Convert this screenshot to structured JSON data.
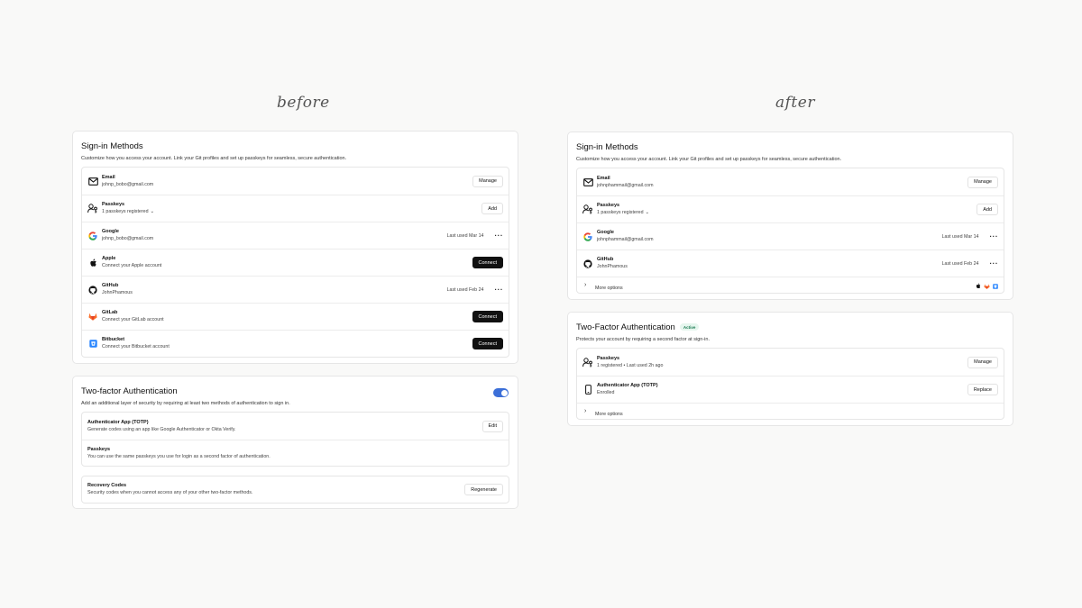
{
  "captions": {
    "before": "before",
    "after": "after"
  },
  "before": {
    "signin": {
      "title": "Sign-in Methods",
      "desc": "Customize how you access your account. Link your Git profiles and set up passkeys for seamless, secure authentication.",
      "email": {
        "label": "Email",
        "value": "johnp_bobo@gmail.com",
        "button": "Manage",
        "icon": "mail-icon"
      },
      "passkeys": {
        "label": "Passkeys",
        "value": "1 passkeys registered",
        "button": "Add",
        "icon": "passkey-icon"
      },
      "google": {
        "label": "Google",
        "value": "johnp_bobo@gmail.com",
        "last_used": "Last used Mar 14",
        "icon": "google-icon"
      },
      "apple": {
        "label": "Apple",
        "value": "Connect your Apple account",
        "button": "Connect",
        "icon": "apple-icon"
      },
      "github": {
        "label": "GitHub",
        "value": "JohnPhamous",
        "last_used": "Last used Feb 24",
        "icon": "github-icon"
      },
      "gitlab": {
        "label": "GitLab",
        "value": "Connect your GitLab account",
        "button": "Connect",
        "icon": "gitlab-icon"
      },
      "bitbucket": {
        "label": "Bitbucket",
        "value": "Connect your Bitbucket account",
        "button": "Connect",
        "icon": "bitbucket-icon"
      }
    },
    "twofa": {
      "title": "Two-factor Authentication",
      "desc": "Add an additional layer of security by requiring at least two methods of authentication to sign in.",
      "toggle_on": true,
      "authenticator": {
        "label": "Authenticator App (TOTP)",
        "value": "Generate codes using an app like Google Authenticator or Okta Verify.",
        "button": "Edit"
      },
      "passkeys": {
        "label": "Passkeys",
        "value": "You can use the same passkeys you use for login as a second factor of authentication."
      },
      "recovery": {
        "label": "Recovery Codes",
        "value": "Security codes when you cannot access any of your other two-factor methods.",
        "button": "Regenerate"
      }
    }
  },
  "after": {
    "signin": {
      "title": "Sign-in Methods",
      "desc": "Customize how you access your account. Link your Git profiles and set up passkeys for seamless, secure authentication.",
      "email": {
        "label": "Email",
        "value": "johnphammail@gmail.com",
        "button": "Manage"
      },
      "passkeys": {
        "label": "Passkeys",
        "value": "1 passkeys registered",
        "button": "Add"
      },
      "google": {
        "label": "Google",
        "value": "johnphammail@gmail.com",
        "last_used": "Last used Mar 14"
      },
      "github": {
        "label": "GitHub",
        "value": "JohnPhamous",
        "last_used": "Last used Feb 24"
      },
      "more": "More options"
    },
    "twofa": {
      "title": "Two-Factor Authentication",
      "badge": "Active",
      "desc": "Protects your account by requiring a second factor at sign-in.",
      "passkeys": {
        "label": "Passkeys",
        "value": "1 registered • Last used 2h ago",
        "button": "Manage"
      },
      "authenticator": {
        "label": "Authenticator App (TOTP)",
        "value": "Enrolled",
        "button": "Replace",
        "icon": "phone-icon"
      },
      "more": "More options"
    }
  },
  "colors": {
    "accent": "#3c6fd8",
    "badge_bg": "#e6f6ee",
    "badge_text": "#1c7a52",
    "dark_button": "#111111"
  }
}
